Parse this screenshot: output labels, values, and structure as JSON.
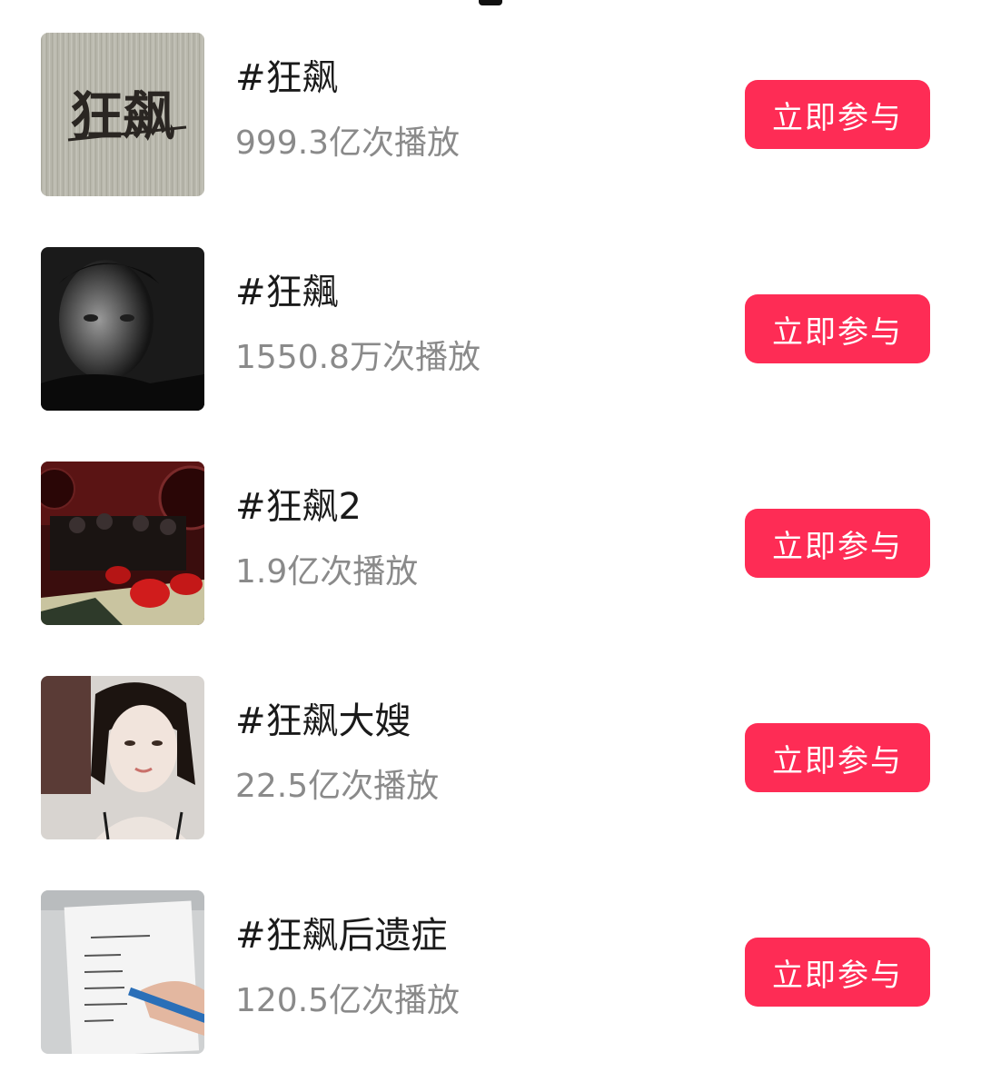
{
  "colors": {
    "accent": "#fe2c55",
    "title_text": "#1a1a1a",
    "meta_text": "#8a8a8a",
    "background": "#ffffff"
  },
  "topics": [
    {
      "title": "#狂飙",
      "plays": "999.3亿次播放",
      "button": "立即参与",
      "thumb_icon": "poster-logo-thumbnail",
      "thumb_text": "狂飙"
    },
    {
      "title": "#狂飆",
      "plays": "1550.8万次播放",
      "button": "立即参与",
      "thumb_icon": "actor-portrait-thumbnail"
    },
    {
      "title": "#狂飙2",
      "plays": "1.9亿次播放",
      "button": "立即参与",
      "thumb_icon": "scene-still-thumbnail"
    },
    {
      "title": "#狂飙大嫂",
      "plays": "22.5亿次播放",
      "button": "立即参与",
      "thumb_icon": "woman-portrait-thumbnail"
    },
    {
      "title": "#狂飙后遗症",
      "plays": "120.5亿次播放",
      "button": "立即参与",
      "thumb_icon": "handwritten-note-thumbnail"
    }
  ]
}
